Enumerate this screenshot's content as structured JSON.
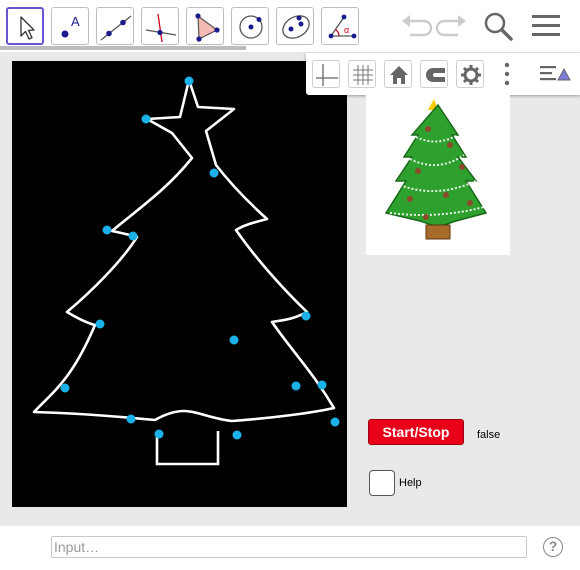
{
  "toolbar": {
    "tools": [
      {
        "name": "move-tool",
        "icon": "arrow-cursor-icon",
        "label": ""
      },
      {
        "name": "point-tool",
        "icon": "point-icon",
        "label": "A"
      },
      {
        "name": "line-tool",
        "icon": "line-through-points-icon",
        "label": ""
      },
      {
        "name": "perpendicular-line-tool",
        "icon": "perpendicular-line-icon",
        "label": ""
      },
      {
        "name": "polygon-tool",
        "icon": "polygon-icon",
        "label": ""
      },
      {
        "name": "circle-tool",
        "icon": "circle-with-center-icon",
        "label": ""
      },
      {
        "name": "conic-tool",
        "icon": "ellipse-icon",
        "label": ""
      },
      {
        "name": "angle-tool",
        "icon": "angle-icon",
        "label": "α"
      }
    ],
    "right_icons": [
      "undo-icon",
      "redo-icon",
      "search-icon",
      "menu-icon"
    ]
  },
  "style_bar": {
    "buttons": [
      "axes-icon",
      "grid-icon",
      "home-icon",
      "point-capturing-icon",
      "settings-icon",
      "more-icon"
    ],
    "toggle_icon": "style-bar-toggle-icon"
  },
  "controls": {
    "start_stop_label": "Start/Stop",
    "start_stop_color": "#e8001a",
    "boolean_value": "false",
    "checkbox_label": "Help",
    "checkbox_checked": false
  },
  "input_bar": {
    "placeholder": "Input…",
    "help_icon": "question-mark-icon"
  },
  "colors": {
    "point_color": "#1ab0e8",
    "canvas_background": "#000000",
    "outline_color": "#ffffff",
    "tree_green": "#2ea02e",
    "tool_accent": "#6557d2"
  }
}
